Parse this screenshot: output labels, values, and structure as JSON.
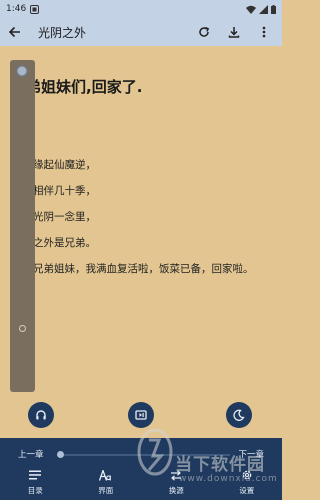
{
  "status_bar": {
    "time": "1:46"
  },
  "toolbar": {
    "title": "光阴之外"
  },
  "chapter": {
    "title": "兄弟姐妹们,回家了.",
    "paragraphs": [
      "缘起仙魔逆，",
      "相伴几十季，",
      "光阴一念里，",
      "之外是兄弟。",
      "兄弟姐妹，我满血复活啦，饭菜已备，回家啦。"
    ]
  },
  "bottom_menu": {
    "prev_chapter": "上一章",
    "next_chapter": "下一章",
    "progress": 0,
    "nav": [
      {
        "label": "目录",
        "icon": "list-icon"
      },
      {
        "label": "界面",
        "icon": "font-icon"
      },
      {
        "label": "换源",
        "icon": "swap-icon"
      },
      {
        "label": "设置",
        "icon": "gear-icon"
      }
    ]
  },
  "watermark": {
    "text": "当下软件园",
    "url": "www.downxia.com"
  },
  "colors": {
    "page_bg": "#e2c590",
    "bar_bg": "#c3d2e4",
    "menu_bg": "#1f3a5e"
  }
}
